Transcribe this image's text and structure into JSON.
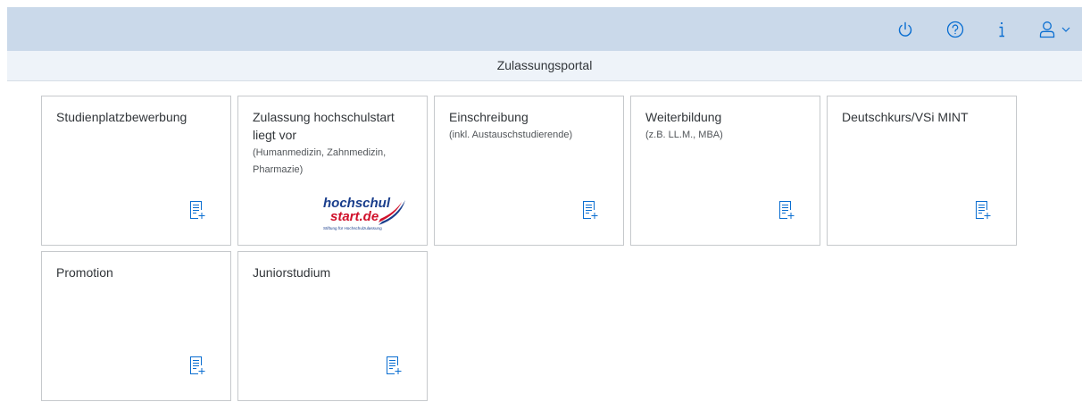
{
  "header": {
    "icons": [
      {
        "name": "power-icon",
        "label": "power"
      },
      {
        "name": "help-icon",
        "label": "help"
      },
      {
        "name": "info-icon",
        "label": "info"
      },
      {
        "name": "user-icon",
        "label": "user"
      }
    ]
  },
  "title": "Zulassungsportal",
  "tiles": [
    {
      "title": "Studienplatzbewerbung",
      "subtitle": "",
      "icon": "form-add-icon"
    },
    {
      "title": "Zulassung hochschulstart liegt vor",
      "subtitle": "(Humanmedizin, Zahnmedizin, Pharmazie)",
      "icon": "hochschulstart-logo"
    },
    {
      "title": "Einschreibung",
      "subtitle": "(inkl. Austauschstudierende)",
      "icon": "form-add-icon"
    },
    {
      "title": "Weiterbildung",
      "subtitle": "(z.B. LL.M., MBA)",
      "icon": "form-add-icon"
    },
    {
      "title": "Deutschkurs/VSi MINT",
      "subtitle": "",
      "icon": "form-add-icon"
    },
    {
      "title": "Promotion",
      "subtitle": "",
      "icon": "form-add-icon"
    },
    {
      "title": "Juniorstudium",
      "subtitle": "",
      "icon": "form-add-icon"
    }
  ],
  "logo": {
    "line1": "hochschul",
    "line2": "start.de",
    "tagline": "Stiftung für Hochschulzulassung"
  },
  "colors": {
    "header_bg": "#cad9ea",
    "title_bar_bg": "#eef3f9",
    "icon_blue": "#0a6ed1",
    "logo_blue": "#1a3e8c",
    "logo_red": "#d0112b"
  }
}
